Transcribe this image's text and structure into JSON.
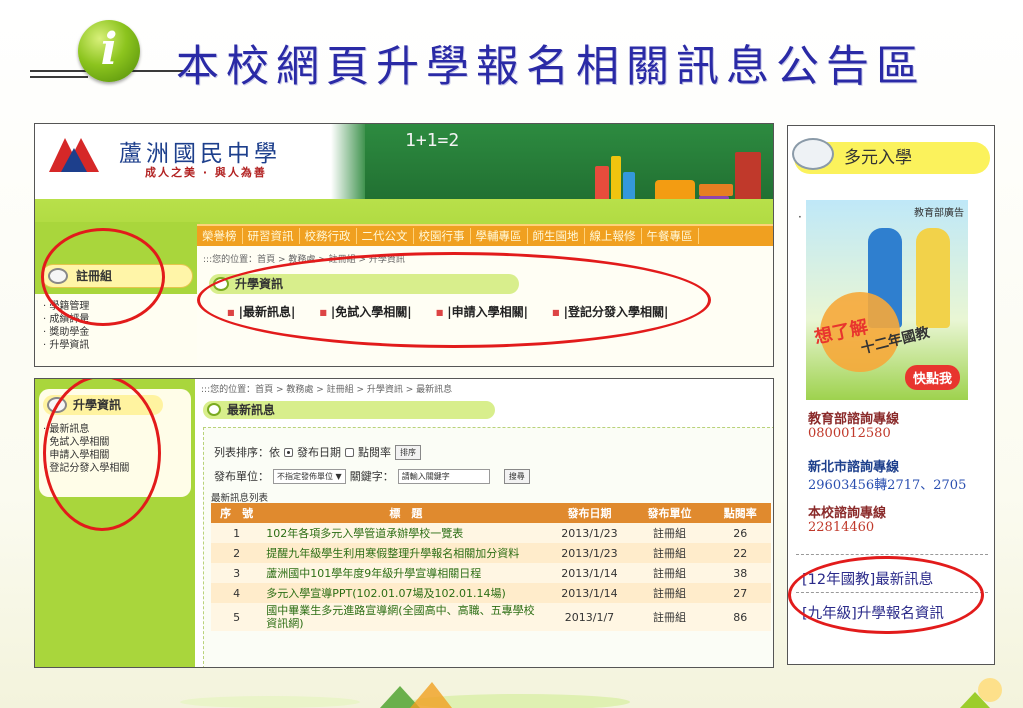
{
  "slide": {
    "title": "本校網頁升學報名相關訊息公告區",
    "icon": "info-icon",
    "icon_glyph": "i"
  },
  "school": {
    "name": "蘆洲國民中學",
    "motto": "成人之美 · 與人為善",
    "board_text": "1+1=2"
  },
  "menu": [
    "榮譽榜",
    "研習資訊",
    "校務行政",
    "二代公文",
    "校園行事",
    "學輔專區",
    "師生園地",
    "線上報修",
    "午餐專區"
  ],
  "top_page": {
    "breadcrumb": ":::您的位置：首頁 > 教務處 > 註冊組 > 升學資訊",
    "section_title": "升學資訊",
    "sub_links": [
      "|最新訊息|",
      "|免試入學相關|",
      "|申請入學相關|",
      "|登記分發入學相關|"
    ],
    "side_title": "註冊組",
    "side_items": [
      "學籍管理",
      "成績評量",
      "獎助學金",
      "升學資訊"
    ]
  },
  "bottom_page": {
    "breadcrumb": ":::您的位置：首頁 > 教務處 > 註冊組 > 升學資訊 > 最新訊息",
    "section_title": "最新訊息",
    "side_title": "升學資訊",
    "side_items": [
      "最新訊息",
      "免試入學相關",
      "申請入學相關",
      "登記分發入學相關"
    ],
    "sort_label": "列表排序：依",
    "sort_option_date": "發布日期",
    "sort_option_clicks": "點閱率",
    "sort_button": "排序",
    "unit_label": "發布單位：",
    "unit_select": "不指定發佈單位",
    "keyword_label": "關鍵字：",
    "keyword_placeholder": "請輸入關鍵字",
    "search_button": "搜尋",
    "list_caption": "最新訊息列表",
    "table": {
      "headers": [
        "序　號",
        "標　題",
        "發布日期",
        "發布單位",
        "點閱率"
      ],
      "rows": [
        {
          "no": "1",
          "title": "102年各項多元入學管道承辦學校一覽表",
          "date": "2013/1/23",
          "unit": "註冊組",
          "clicks": "26"
        },
        {
          "no": "2",
          "title": "提醒九年級學生利用寒假整理升學報名相關加分資料",
          "date": "2013/1/23",
          "unit": "註冊組",
          "clicks": "22"
        },
        {
          "no": "3",
          "title": "蘆洲國中101學年度9年級升學宣導相關日程",
          "date": "2013/1/14",
          "unit": "註冊組",
          "clicks": "38"
        },
        {
          "no": "4",
          "title": "多元入學宣導PPT(102.01.07場及102.01.14場)",
          "date": "2013/1/14",
          "unit": "註冊組",
          "clicks": "27"
        },
        {
          "no": "5",
          "title": "國中畢業生多元進路宣導網(全國高中、高職、五專學校資訊網)",
          "date": "2013/1/7",
          "unit": "註冊組",
          "clicks": "86"
        }
      ]
    }
  },
  "side_panel": {
    "title": "多元入學",
    "ad_label": "教育部廣告",
    "ad_line1": "想了解",
    "ad_line2": "十二年國教",
    "ad_button": "快點我",
    "hotlines": [
      {
        "name": "教育部諮詢專線",
        "number": "0800012580"
      },
      {
        "name": "新北市諮詢專線",
        "number": "29603456轉2717、2705"
      },
      {
        "name": "本校諮詢專線",
        "number": "22814460"
      }
    ],
    "links": [
      "[12年國教]最新訊息",
      "[九年級]升學報名資訊"
    ]
  },
  "colors": {
    "title_blue": "#2a2aa6",
    "highlight_red": "#e21b1b",
    "menu_orange": "#f0a020",
    "table_header": "#e08a2e",
    "site_green": "#a9d63c"
  }
}
